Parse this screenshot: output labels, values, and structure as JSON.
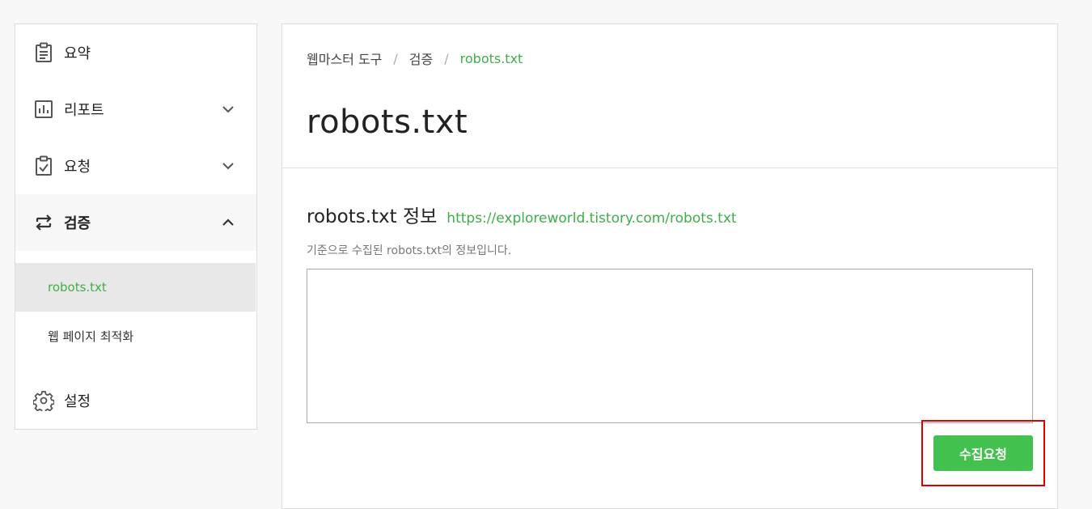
{
  "sidebar": {
    "items": [
      {
        "label": "요약",
        "icon": "clipboard-icon"
      },
      {
        "label": "리포트",
        "icon": "bar-chart-icon"
      },
      {
        "label": "요청",
        "icon": "clipboard-check-icon"
      },
      {
        "label": "검증",
        "icon": "repeat-arrows-icon"
      },
      {
        "label": "설정",
        "icon": "gear-icon"
      }
    ],
    "sub_items": [
      {
        "label": "robots.txt",
        "active": true
      },
      {
        "label": "웹 페이지 최적화",
        "active": false
      }
    ]
  },
  "breadcrumb": [
    "웹마스터 도구",
    "검증",
    "robots.txt"
  ],
  "page_title": "robots.txt",
  "section": {
    "title": "robots.txt 정보",
    "url": "https://exploreworld.tistory.com/robots.txt",
    "description": "기준으로 수집된 robots.txt의 정보입니다.",
    "content": ""
  },
  "request_button": "수집요청",
  "colors": {
    "accent_green": "#3fae49",
    "button_green": "#43c14f",
    "highlight_red": "#e00000"
  }
}
